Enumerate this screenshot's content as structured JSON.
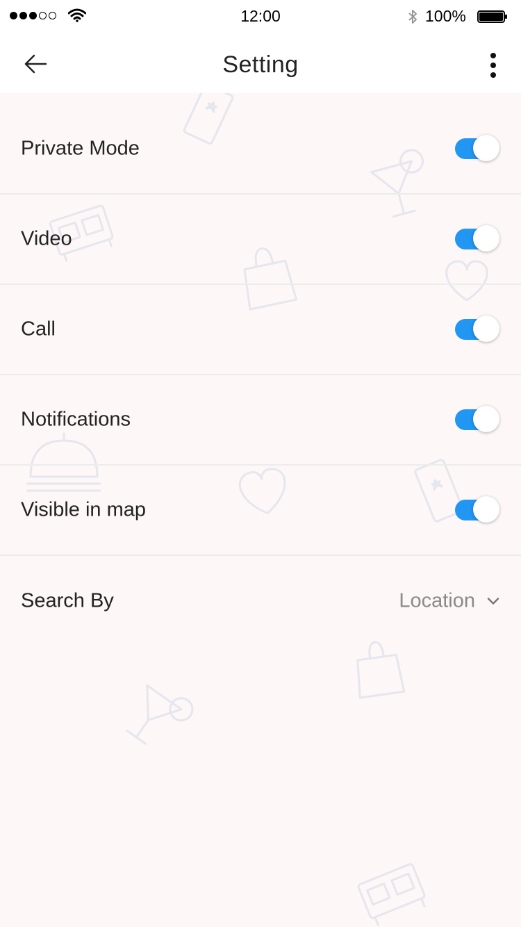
{
  "status_bar": {
    "time": "12:00",
    "battery": "100%",
    "signal_icon": "signal-dots-icon",
    "wifi_icon": "wifi-icon",
    "bluetooth_icon": "bluetooth-icon",
    "battery_icon": "battery-icon"
  },
  "header": {
    "title": "Setting",
    "back_icon": "back-arrow-icon",
    "more_icon": "more-vertical-icon"
  },
  "settings": [
    {
      "label": "Private Mode",
      "enabled": true
    },
    {
      "label": "Video",
      "enabled": true
    },
    {
      "label": "Call",
      "enabled": true
    },
    {
      "label": "Notifications",
      "enabled": true
    },
    {
      "label": "Visible in map",
      "enabled": true
    }
  ],
  "search_by": {
    "label": "Search By",
    "value": "Location",
    "icon": "chevron-down-icon"
  },
  "colors": {
    "accent": "#2196f3",
    "background": "#fdf7f7"
  }
}
